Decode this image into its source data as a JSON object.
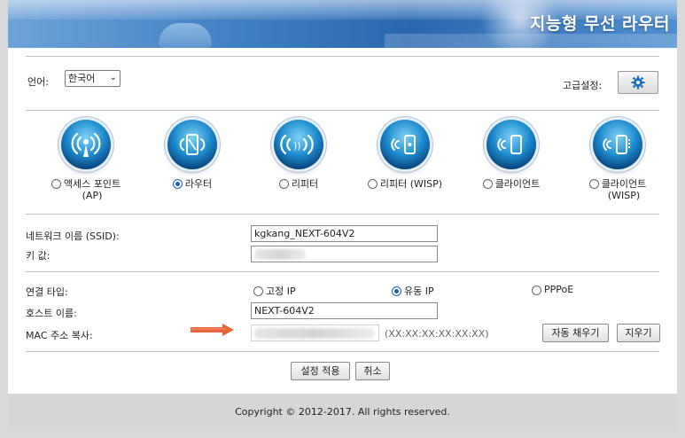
{
  "banner": {
    "title": "지능형 무선 라우터"
  },
  "language": {
    "label": "언어:",
    "selected": "한국어"
  },
  "advanced": {
    "label": "고급설정:",
    "icon": "gear-icon"
  },
  "modes": [
    {
      "label": "액세스 포인트 (AP)",
      "line1": "액세스 포인트",
      "line2": "(AP)",
      "selected": false,
      "icon": "access-point-icon"
    },
    {
      "label": "라우터",
      "line1": "라우터",
      "line2": "",
      "selected": true,
      "icon": "router-icon"
    },
    {
      "label": "리피터",
      "line1": "리피터",
      "line2": "",
      "selected": false,
      "icon": "repeater-icon"
    },
    {
      "label": "리피터 (WISP)",
      "line1": "리피터 (WISP)",
      "line2": "",
      "selected": false,
      "icon": "repeater-wisp-icon"
    },
    {
      "label": "클라이언트",
      "line1": "클라이언트",
      "line2": "",
      "selected": false,
      "icon": "client-icon"
    },
    {
      "label": "클라이언트 (WISP)",
      "line1": "클라이언트",
      "line2": "(WISP)",
      "selected": false,
      "icon": "client-wisp-icon"
    }
  ],
  "wifi": {
    "ssid_label": "네트워크 이름 (SSID):",
    "ssid_value": "kgkang_NEXT-604V2",
    "key_label": "키 값:"
  },
  "wan": {
    "conn_type_label": "연결 타입:",
    "options": [
      {
        "label": "고정 IP",
        "selected": false
      },
      {
        "label": "유동 IP",
        "selected": true
      },
      {
        "label": "PPPoE",
        "selected": false
      }
    ],
    "hostname_label": "호스트 이름:",
    "hostname_value": "NEXT-604V2",
    "mac_label": "MAC 주소 복사:",
    "mac_hint": "(XX:XX:XX:XX:XX:XX)",
    "autofill_label": "자동 채우기",
    "clear_label": "지우기"
  },
  "actions": {
    "apply_label": "설정 적용",
    "cancel_label": "취소"
  },
  "footer": {
    "copyright": "Copyright © 2012-2017. All rights reserved."
  },
  "colors": {
    "banner": "#2a67b1",
    "radio_selected": "#1a5fb4",
    "arrow": "#e8643a"
  }
}
